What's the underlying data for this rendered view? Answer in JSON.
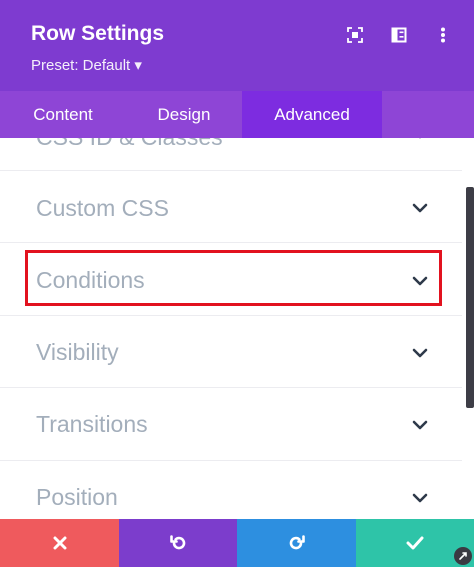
{
  "header": {
    "title": "Row Settings",
    "preset_label": "Preset: Default ▾",
    "icons": [
      "focus-icon",
      "split-panel-icon",
      "more-vertical-icon"
    ]
  },
  "tabs": [
    {
      "label": "Content",
      "active": false
    },
    {
      "label": "Design",
      "active": false
    },
    {
      "label": "Advanced",
      "active": true
    }
  ],
  "sections": [
    {
      "label": "CSS ID & Classes"
    },
    {
      "label": "Custom CSS"
    },
    {
      "label": "Conditions",
      "highlighted": true
    },
    {
      "label": "Visibility"
    },
    {
      "label": "Transitions"
    },
    {
      "label": "Position"
    }
  ],
  "footer": {
    "buttons": [
      "close-icon",
      "undo-icon",
      "redo-icon",
      "check-icon"
    ]
  },
  "colors": {
    "header_bg": "#7e3bd0",
    "tabs_bg": "#8e45d6",
    "active_tab_bg": "#7d2ce0",
    "label_text": "#a3aebb",
    "highlight_border": "#e2121f",
    "close_bg": "#ef5a5d",
    "undo_bg": "#7c3dcc",
    "redo_bg": "#2d8fe0",
    "save_bg": "#2ec4a8"
  }
}
